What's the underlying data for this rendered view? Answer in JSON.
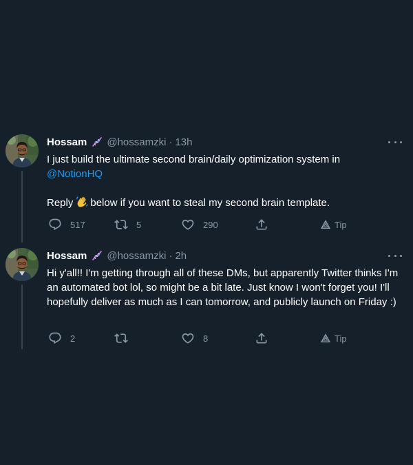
{
  "tweets": [
    {
      "author": "Hossam",
      "handle": "@hossamzki",
      "separator": "·",
      "time": "13h",
      "line1": "I just build the ultimate second brain/daily optimization system in",
      "mention": "@NotionHQ",
      "reply_before": "Reply",
      "reply_after": "below if you want to steal my second brain template.",
      "replies": "517",
      "retweets": "5",
      "likes": "290",
      "tip": "Tip"
    },
    {
      "author": "Hossam",
      "handle": "@hossamzki",
      "separator": "·",
      "time": "2h",
      "text": "Hi y'all!! I'm getting through all of these DMs, but apparently Twitter thinks I'm an automated bot lol, so might be a bit late. Just know I won't forget you! I'll hopefully deliver as much as I can tomorrow, and publicly launch on Friday :)",
      "replies": "2",
      "retweets": "",
      "likes": "8",
      "tip": "Tip"
    }
  ],
  "icons": {
    "reply": "reply-icon",
    "retweet": "retweet-icon",
    "like": "heart-icon",
    "share": "share-icon",
    "tip": "tip-icon",
    "more": "more-icon",
    "dna": "dna-emoji-icon",
    "wave": "waving-hand-emoji-icon"
  },
  "colors": {
    "background": "#15202b",
    "text": "#ffffff",
    "muted": "#8b98a5",
    "link": "#1d9bf0",
    "thread_line": "#38444d"
  }
}
